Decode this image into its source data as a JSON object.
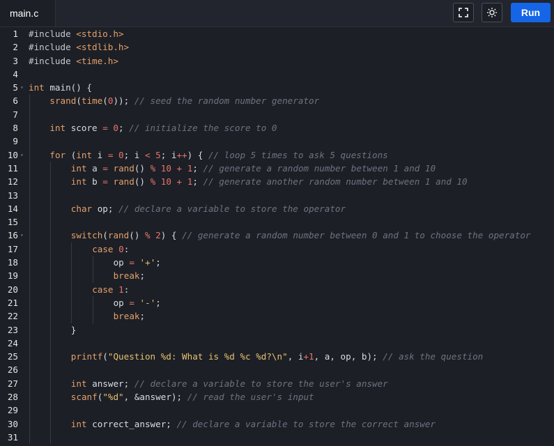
{
  "tab": {
    "label": "main.c"
  },
  "toolbar": {
    "run_label": "Run",
    "fullscreen_icon": "fullscreen-icon",
    "theme_icon": "sun-icon"
  },
  "colors": {
    "run": "#1565e6",
    "background": "#1c1f26"
  },
  "code_lines": [
    {
      "n": "1",
      "indent": 0,
      "fold": false,
      "tokens": [
        [
          "pp",
          "#include "
        ],
        [
          "inc",
          "<stdio.h>"
        ]
      ]
    },
    {
      "n": "2",
      "indent": 0,
      "fold": false,
      "tokens": [
        [
          "pp",
          "#include "
        ],
        [
          "inc",
          "<stdlib.h>"
        ]
      ]
    },
    {
      "n": "3",
      "indent": 0,
      "fold": false,
      "tokens": [
        [
          "pp",
          "#include "
        ],
        [
          "inc",
          "<time.h>"
        ]
      ]
    },
    {
      "n": "4",
      "indent": 0,
      "fold": false,
      "tokens": []
    },
    {
      "n": "5",
      "indent": 0,
      "fold": true,
      "tokens": [
        [
          "kw",
          "int"
        ],
        [
          "id",
          " main() {"
        ]
      ]
    },
    {
      "n": "6",
      "indent": 1,
      "fold": false,
      "tokens": [
        [
          "fn",
          "srand"
        ],
        [
          "id",
          "("
        ],
        [
          "fn",
          "time"
        ],
        [
          "id",
          "("
        ],
        [
          "num",
          "0"
        ],
        [
          "id",
          "));"
        ],
        [
          "cm",
          " // seed the random number generator"
        ]
      ]
    },
    {
      "n": "7",
      "indent": 1,
      "fold": false,
      "tokens": []
    },
    {
      "n": "8",
      "indent": 1,
      "fold": false,
      "tokens": [
        [
          "kw",
          "int"
        ],
        [
          "id",
          " score "
        ],
        [
          "op",
          "="
        ],
        [
          "id",
          " "
        ],
        [
          "num",
          "0"
        ],
        [
          "id",
          ";"
        ],
        [
          "cm",
          " // initialize the score to 0"
        ]
      ]
    },
    {
      "n": "9",
      "indent": 1,
      "fold": false,
      "tokens": []
    },
    {
      "n": "10",
      "indent": 1,
      "fold": true,
      "tokens": [
        [
          "kw",
          "for"
        ],
        [
          "id",
          " ("
        ],
        [
          "kw",
          "int"
        ],
        [
          "id",
          " i "
        ],
        [
          "op",
          "="
        ],
        [
          "id",
          " "
        ],
        [
          "num",
          "0"
        ],
        [
          "id",
          "; i "
        ],
        [
          "op",
          "<"
        ],
        [
          "id",
          " "
        ],
        [
          "num",
          "5"
        ],
        [
          "id",
          "; i"
        ],
        [
          "op",
          "++"
        ],
        [
          "id",
          ") {"
        ],
        [
          "cm",
          " // loop 5 times to ask 5 questions"
        ]
      ]
    },
    {
      "n": "11",
      "indent": 2,
      "fold": false,
      "tokens": [
        [
          "kw",
          "int"
        ],
        [
          "id",
          " a "
        ],
        [
          "op",
          "="
        ],
        [
          "id",
          " "
        ],
        [
          "fn",
          "rand"
        ],
        [
          "id",
          "() "
        ],
        [
          "op",
          "%"
        ],
        [
          "id",
          " "
        ],
        [
          "num",
          "10"
        ],
        [
          "id",
          " "
        ],
        [
          "op",
          "+"
        ],
        [
          "id",
          " "
        ],
        [
          "num",
          "1"
        ],
        [
          "id",
          ";"
        ],
        [
          "cm",
          " // generate a random number between 1 and 10"
        ]
      ]
    },
    {
      "n": "12",
      "indent": 2,
      "fold": false,
      "tokens": [
        [
          "kw",
          "int"
        ],
        [
          "id",
          " b "
        ],
        [
          "op",
          "="
        ],
        [
          "id",
          " "
        ],
        [
          "fn",
          "rand"
        ],
        [
          "id",
          "() "
        ],
        [
          "op",
          "%"
        ],
        [
          "id",
          " "
        ],
        [
          "num",
          "10"
        ],
        [
          "id",
          " "
        ],
        [
          "op",
          "+"
        ],
        [
          "id",
          " "
        ],
        [
          "num",
          "1"
        ],
        [
          "id",
          ";"
        ],
        [
          "cm",
          " // generate another random number between 1 and 10"
        ]
      ]
    },
    {
      "n": "13",
      "indent": 2,
      "fold": false,
      "tokens": []
    },
    {
      "n": "14",
      "indent": 2,
      "fold": false,
      "tokens": [
        [
          "kw",
          "char"
        ],
        [
          "id",
          " op;"
        ],
        [
          "cm",
          " // declare a variable to store the operator"
        ]
      ]
    },
    {
      "n": "15",
      "indent": 2,
      "fold": false,
      "tokens": []
    },
    {
      "n": "16",
      "indent": 2,
      "fold": true,
      "tokens": [
        [
          "kw",
          "switch"
        ],
        [
          "id",
          "("
        ],
        [
          "fn",
          "rand"
        ],
        [
          "id",
          "() "
        ],
        [
          "op",
          "%"
        ],
        [
          "id",
          " "
        ],
        [
          "num",
          "2"
        ],
        [
          "id",
          ") {"
        ],
        [
          "cm",
          " // generate a random number between 0 and 1 to choose the operator"
        ]
      ]
    },
    {
      "n": "17",
      "indent": 3,
      "fold": false,
      "tokens": [
        [
          "kw",
          "case"
        ],
        [
          "id",
          " "
        ],
        [
          "num",
          "0"
        ],
        [
          "id",
          ":"
        ]
      ]
    },
    {
      "n": "18",
      "indent": 4,
      "fold": false,
      "tokens": [
        [
          "id",
          "op "
        ],
        [
          "op",
          "="
        ],
        [
          "id",
          " "
        ],
        [
          "str",
          "'+'"
        ],
        [
          "id",
          ";"
        ]
      ]
    },
    {
      "n": "19",
      "indent": 4,
      "fold": false,
      "tokens": [
        [
          "kw",
          "break"
        ],
        [
          "id",
          ";"
        ]
      ]
    },
    {
      "n": "20",
      "indent": 3,
      "fold": false,
      "tokens": [
        [
          "kw",
          "case"
        ],
        [
          "id",
          " "
        ],
        [
          "num",
          "1"
        ],
        [
          "id",
          ":"
        ]
      ]
    },
    {
      "n": "21",
      "indent": 4,
      "fold": false,
      "tokens": [
        [
          "id",
          "op "
        ],
        [
          "op",
          "="
        ],
        [
          "id",
          " "
        ],
        [
          "str",
          "'-'"
        ],
        [
          "id",
          ";"
        ]
      ]
    },
    {
      "n": "22",
      "indent": 4,
      "fold": false,
      "tokens": [
        [
          "kw",
          "break"
        ],
        [
          "id",
          ";"
        ]
      ]
    },
    {
      "n": "23",
      "indent": 2,
      "fold": false,
      "tokens": [
        [
          "id",
          "}"
        ]
      ]
    },
    {
      "n": "24",
      "indent": 2,
      "fold": false,
      "tokens": []
    },
    {
      "n": "25",
      "indent": 2,
      "fold": false,
      "tokens": [
        [
          "fn",
          "printf"
        ],
        [
          "id",
          "("
        ],
        [
          "str",
          "\"Question %d: What is %d %c %d?\\n\""
        ],
        [
          "id",
          ", i"
        ],
        [
          "op",
          "+"
        ],
        [
          "num",
          "1"
        ],
        [
          "id",
          ", a, op, b);"
        ],
        [
          "cm",
          " // ask the question"
        ]
      ]
    },
    {
      "n": "26",
      "indent": 2,
      "fold": false,
      "tokens": []
    },
    {
      "n": "27",
      "indent": 2,
      "fold": false,
      "tokens": [
        [
          "kw",
          "int"
        ],
        [
          "id",
          " answer;"
        ],
        [
          "cm",
          " // declare a variable to store the user's answer"
        ]
      ]
    },
    {
      "n": "28",
      "indent": 2,
      "fold": false,
      "tokens": [
        [
          "fn",
          "scanf"
        ],
        [
          "id",
          "("
        ],
        [
          "str",
          "\"%d\""
        ],
        [
          "id",
          ", &answer);"
        ],
        [
          "cm",
          " // read the user's input"
        ]
      ]
    },
    {
      "n": "29",
      "indent": 2,
      "fold": false,
      "tokens": []
    },
    {
      "n": "30",
      "indent": 2,
      "fold": false,
      "tokens": [
        [
          "kw",
          "int"
        ],
        [
          "id",
          " correct_answer;"
        ],
        [
          "cm",
          " // declare a variable to store the correct answer"
        ]
      ]
    },
    {
      "n": "31",
      "indent": 2,
      "fold": false,
      "tokens": []
    }
  ]
}
